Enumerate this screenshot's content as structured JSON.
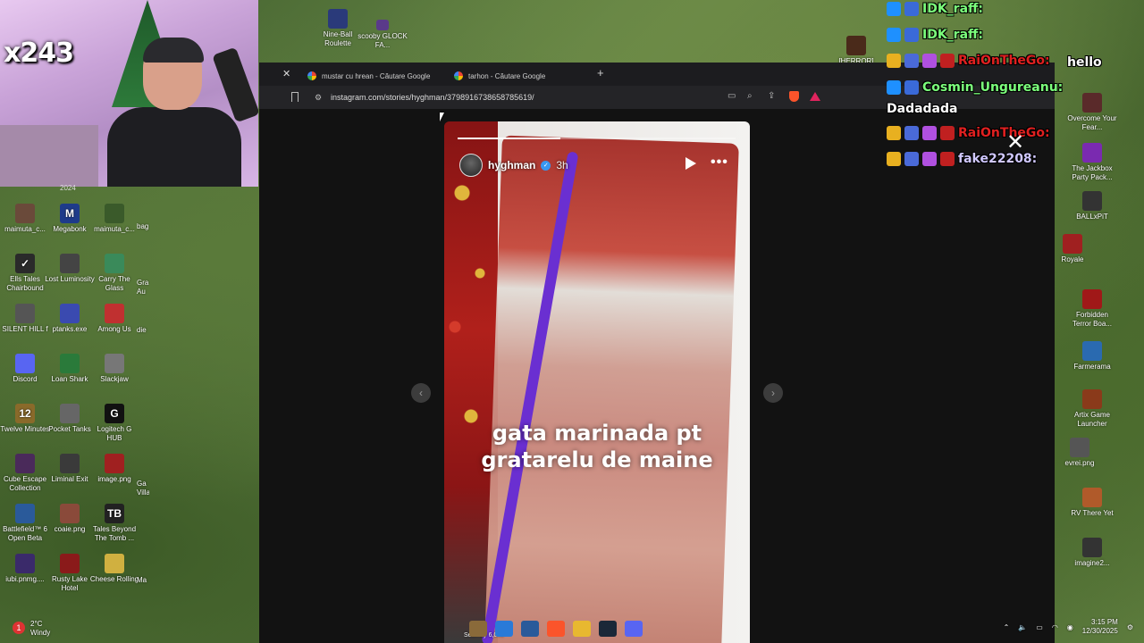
{
  "webcam": {
    "multiplier": "x243",
    "date_fragment": "2024"
  },
  "desktop_left": [
    {
      "label": "maimuta_c...",
      "color": "#6a4a3a",
      "glyph": ""
    },
    {
      "label": "Megabonk",
      "color": "#1e3b8a",
      "glyph": "M"
    },
    {
      "label": "maimuta_c...",
      "color": "#3a5a2a",
      "glyph": ""
    },
    {
      "label": "Ells Tales Chairbound",
      "color": "#2a2a2a",
      "glyph": "✓"
    },
    {
      "label": "Lost Luminosity",
      "color": "#444",
      "glyph": ""
    },
    {
      "label": "Carry The Glass",
      "color": "#3a8a5a",
      "glyph": ""
    },
    {
      "label": "SILENT HILL f",
      "color": "#555",
      "glyph": ""
    },
    {
      "label": "ptanks.exe",
      "color": "#3a4ab0",
      "glyph": ""
    },
    {
      "label": "Among Us",
      "color": "#c03030",
      "glyph": ""
    },
    {
      "label": "Discord",
      "color": "#5865f2",
      "glyph": ""
    },
    {
      "label": "Loan Shark",
      "color": "#2a7a3a",
      "glyph": ""
    },
    {
      "label": "Slackjaw",
      "color": "#777",
      "glyph": ""
    },
    {
      "label": "Twelve Minutes",
      "color": "#8a6a2a",
      "glyph": "12"
    },
    {
      "label": "Pocket Tanks",
      "color": "#666",
      "glyph": ""
    },
    {
      "label": "Logitech G HUB",
      "color": "#111",
      "glyph": "G"
    },
    {
      "label": "Cube Escape Collection",
      "color": "#4a2a5a",
      "glyph": ""
    },
    {
      "label": "Liminal Exit",
      "color": "#3a3a3a",
      "glyph": ""
    },
    {
      "label": "image.png",
      "color": "#a02020",
      "glyph": ""
    },
    {
      "label": "Battlefield™ 6 Open Beta",
      "color": "#2a5a9a",
      "glyph": ""
    },
    {
      "label": "coaie.png",
      "color": "#8a4a3a",
      "glyph": ""
    },
    {
      "label": "Tales Beyond The Tomb ...",
      "color": "#222",
      "glyph": "TB"
    },
    {
      "label": "iubi.pnmg....",
      "color": "#3a2a6a",
      "glyph": ""
    },
    {
      "label": "Rusty Lake Hotel",
      "color": "#8a1a1a",
      "glyph": ""
    },
    {
      "label": "Cheese Rolling",
      "color": "#d0b040",
      "glyph": ""
    }
  ],
  "desktop_left_partial": [
    "bag",
    "Gra Au",
    "die",
    "Ga Villa",
    "Ma"
  ],
  "desktop_top": [
    {
      "label": "Nine-Ball Roulette",
      "color": "#2a3a7a"
    },
    {
      "label": "scooby GLOCK FA...",
      "color": "#5a3a8a"
    }
  ],
  "desktop_right": [
    {
      "label": "[HERROR]",
      "color": "#4a2a1a"
    },
    {
      "label": "hello",
      "color": "#222"
    },
    {
      "label": "Overcome Your Fear...",
      "color": "#5a2a2a"
    },
    {
      "label": "The Jackbox Party Pack...",
      "color": "#7a2ab0"
    },
    {
      "label": "BALLxPiT",
      "color": "#333"
    },
    {
      "label": "Royale",
      "color": "#a02020"
    },
    {
      "label": "Forbidden Terror Boa...",
      "color": "#a01818"
    },
    {
      "label": "Farmerama",
      "color": "#2a6ab0"
    },
    {
      "label": "Artix Game Launcher",
      "color": "#8a3a1a"
    },
    {
      "label": "evrei.png",
      "color": "#555"
    },
    {
      "label": "RV There Yet",
      "color": "#b05a2a"
    },
    {
      "label": "imagine2...",
      "color": "#333"
    }
  ],
  "browser": {
    "tabs": [
      {
        "label": "mustar cu hrean - Căutare Google"
      },
      {
        "label": "tarhon - Căutare Google"
      }
    ],
    "url": "instagram.com/stories/hyghman/3798916738658785619/"
  },
  "story": {
    "username": "hyghman",
    "time": "3h",
    "caption_line1": "gata marinada pt",
    "caption_line2": "gratarelu de maine",
    "seen_by": "Seen by 6,040",
    "progress": 0.37
  },
  "chat": {
    "lines": [
      {
        "name": "IDK_raff:",
        "color": "#7cff7c"
      },
      {
        "name": "IDK_raff:",
        "color": "#7cff7c"
      },
      {
        "name": "RaiOnTheGo:",
        "color": "#e02020"
      },
      {
        "name": "Cosmin_Ungureanu:",
        "color": "#7cff7c"
      },
      {
        "name": "RaiOnTheGo:",
        "color": "#e02020"
      },
      {
        "name": "fake22208:",
        "color": "#d0c8ff"
      }
    ],
    "msg_hello": "hello",
    "msg_dadadada": "Dadadada"
  },
  "taskbar": {
    "weather_temp": "2°C",
    "weather_desc": "Windy",
    "time": "3:15 PM",
    "date": "12/30/2025"
  }
}
